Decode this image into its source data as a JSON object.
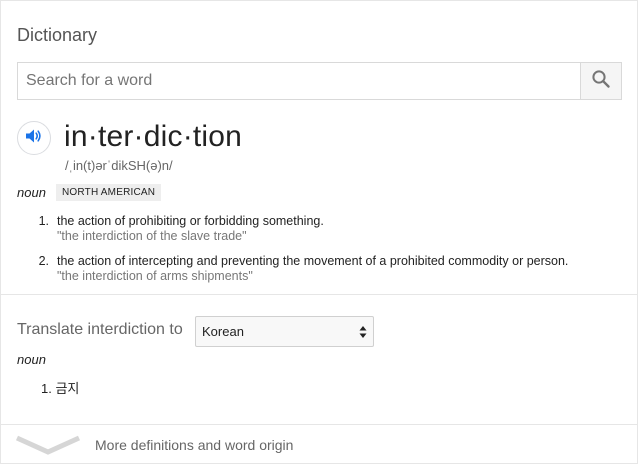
{
  "header": {
    "title": "Dictionary"
  },
  "search": {
    "placeholder": "Search for a word",
    "value": "",
    "icon": "search-icon"
  },
  "entry": {
    "word": "in·ter·dic·tion",
    "phonetic": "/ˌin(t)ərˈdikSH(ə)n/",
    "speaker_icon": "speaker-icon",
    "part_of_speech": "noun",
    "region_badge": "NORTH AMERICAN",
    "definitions": [
      {
        "number": "1.",
        "text": "the action of prohibiting or forbidding something.",
        "example": "\"the interdiction of the slave trade\""
      },
      {
        "number": "2.",
        "text": "the action of intercepting and preventing the movement of a prohibited commodity or person.",
        "example": "\"the interdiction of arms shipments\""
      }
    ]
  },
  "translate": {
    "label": "Translate interdiction to",
    "selected_language": "Korean",
    "part_of_speech": "noun",
    "results": [
      {
        "number": "1.",
        "text": "금지"
      }
    ]
  },
  "footer": {
    "more_label": "More definitions and word origin",
    "icon": "chevron-down-icon"
  },
  "colors": {
    "accent": "#1a73e8",
    "muted_text": "#666666",
    "badge_bg": "#eeeeee"
  }
}
